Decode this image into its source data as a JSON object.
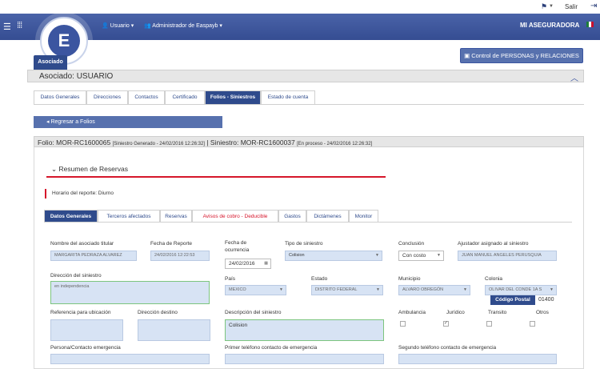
{
  "util": {
    "flag_icon": "flag-icon",
    "salir": "Salir",
    "exit_icon": "exit-icon"
  },
  "header": {
    "user_menu": "Usuario",
    "admin_menu": "Administrador de Easpayb",
    "app_title": "MI ASEGURADORA"
  },
  "asociado_tab": "Asociado",
  "control_button": "Control de PERSONAS y RELACIONES",
  "panel_title": "Asociado: USUARIO",
  "outer_tabs": [
    "Datos Generales",
    "Direcciones",
    "Contactos",
    "Certificado",
    "Folios - Siniestros",
    "Estado de cuenta"
  ],
  "back_button": "Regresar a Folios",
  "folio": {
    "folio_label": "Folio: MOR-RC1600065",
    "folio_meta": "[Siniestro Generado - 24/02/2016 12:26:32]",
    "siniestro_label": "| Siniestro: MOR-RC1600037",
    "siniestro_meta": "[En proceso - 24/02/2016 12:26:32]"
  },
  "resumen_title": "Resumen de Reservas",
  "horario": "Horario del reporte: Diurno",
  "inner_tabs": [
    "Datos Generales",
    "Terceros afectados",
    "Reservas",
    "Avisos de cobro - Deducible",
    "Gastos",
    "Dictámenes",
    "Monitor"
  ],
  "form": {
    "nombre_label": "Nombre del asociado titular",
    "nombre_value": "MARGARITA PEDRAZA ALVAREZ",
    "fecha_reporte_label": "Fecha de Reporte",
    "fecha_reporte_value": "24/02/2016 12:22:53",
    "fecha_ocurrencia_label1": "Fecha de",
    "fecha_ocurrencia_label2": "ocurrencia",
    "fecha_ocurrencia_value": "24/02/2016",
    "tipo_label": "Tipo de siniestro",
    "tipo_value": "Colision",
    "conclusion_label": "Conclusión",
    "conclusion_value": "Con costo",
    "ajustador_label": "Ajustador asignado al siniestro",
    "ajustador_value": "JUAN MANUEL ANGELES PERUSQUIA",
    "direccion_label": "Dirección del siniestro",
    "direccion_value": "en independencia",
    "pais_label": "País",
    "pais_value": "MEXICO",
    "estado_label": "Estado",
    "estado_value": "DISTRITO FEDERAL",
    "municipio_label": "Municipio",
    "municipio_value": "ALVARO OBREGÓN",
    "colonia_label": "Colonia",
    "colonia_value": "OLIVAR DEL CONDE 1A S",
    "codigo_postal_label": "Código Postal",
    "codigo_postal_value": "01400",
    "referencia_label": "Referencia para ubicación",
    "destino_label": "Dirección destino",
    "descripcion_label": "Descripción del siniestro",
    "descripcion_value": "Colision",
    "ambulancia_label": "Ambulancia",
    "juridico_label": "Jurídico",
    "transito_label": "Transito",
    "otros_label": "Otros",
    "persona_label": "Persona/Contacto emergencia",
    "primer_tel_label": "Primer teléfono contacto de emergencia",
    "segundo_tel_label": "Segundo teléfono contacto de emergencia"
  }
}
